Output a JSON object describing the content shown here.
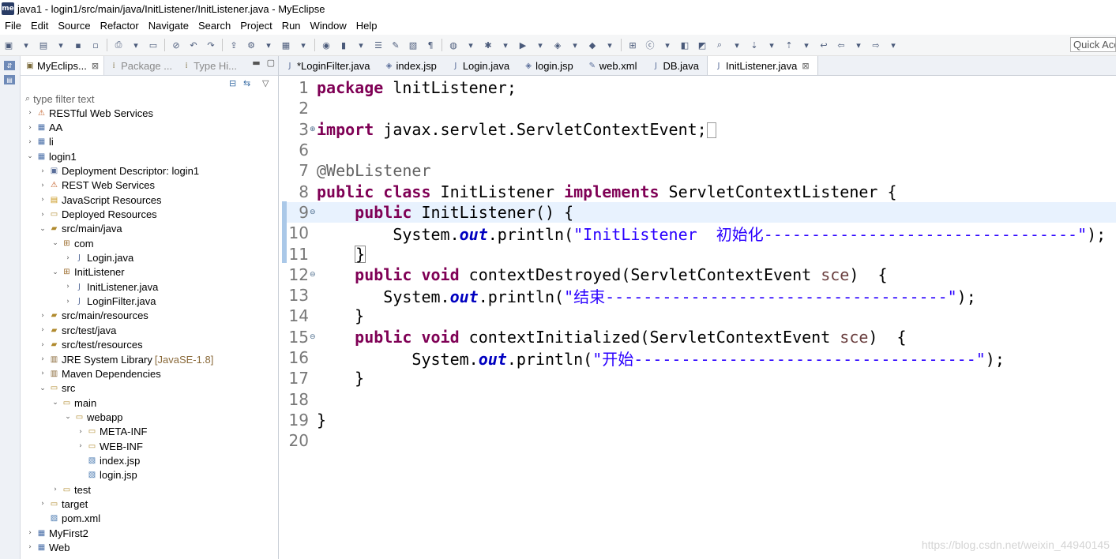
{
  "window": {
    "title": "java1 - login1/src/main/java/InitListener/InitListener.java - MyEclipse",
    "app_badge": "me"
  },
  "menu": [
    "File",
    "Edit",
    "Source",
    "Refactor",
    "Navigate",
    "Search",
    "Project",
    "Run",
    "Window",
    "Help"
  ],
  "quick_access": "Quick Access",
  "explorer": {
    "tabs": [
      {
        "label": "MyEclips...",
        "close": "⊠"
      },
      {
        "label": "Package ..."
      },
      {
        "label": "Type Hi..."
      }
    ],
    "filter_placeholder": "type filter text",
    "tree": [
      {
        "label": "RESTful Web Services",
        "indent": 0,
        "icon": "rest-icon",
        "chev": "›"
      },
      {
        "label": "AA",
        "indent": 0,
        "icon": "project-icon",
        "chev": "›"
      },
      {
        "label": "li",
        "indent": 0,
        "icon": "project-icon",
        "chev": "›"
      },
      {
        "label": "login1",
        "indent": 0,
        "icon": "project-icon",
        "chev": "⌄"
      },
      {
        "label": "Deployment Descriptor: login1",
        "indent": 1,
        "icon": "descriptor-icon",
        "chev": "›"
      },
      {
        "label": "REST Web Services",
        "indent": 1,
        "icon": "rest-icon",
        "chev": "›"
      },
      {
        "label": "JavaScript Resources",
        "indent": 1,
        "icon": "js-icon",
        "chev": "›"
      },
      {
        "label": "Deployed Resources",
        "indent": 1,
        "icon": "folder-icon",
        "chev": "›"
      },
      {
        "label": "src/main/java",
        "indent": 1,
        "icon": "source-folder-icon",
        "chev": "⌄"
      },
      {
        "label": "com",
        "indent": 2,
        "icon": "package-icon",
        "chev": "⌄"
      },
      {
        "label": "Login.java",
        "indent": 3,
        "icon": "java-file-icon",
        "chev": "›"
      },
      {
        "label": "InitListener",
        "indent": 2,
        "icon": "package-icon",
        "chev": "⌄"
      },
      {
        "label": "InitListener.java",
        "indent": 3,
        "icon": "java-file-icon",
        "chev": "›"
      },
      {
        "label": "LoginFilter.java",
        "indent": 3,
        "icon": "java-file-icon",
        "chev": "›"
      },
      {
        "label": "src/main/resources",
        "indent": 1,
        "icon": "source-folder-icon",
        "chev": "›"
      },
      {
        "label": "src/test/java",
        "indent": 1,
        "icon": "source-folder-icon",
        "chev": "›"
      },
      {
        "label": "src/test/resources",
        "indent": 1,
        "icon": "source-folder-icon",
        "chev": "›"
      },
      {
        "label": "JRE System Library",
        "extra": "[JavaSE-1.8]",
        "indent": 1,
        "icon": "library-icon",
        "chev": "›"
      },
      {
        "label": "Maven Dependencies",
        "indent": 1,
        "icon": "library-icon",
        "chev": "›"
      },
      {
        "label": "src",
        "indent": 1,
        "icon": "folder-icon",
        "chev": "⌄"
      },
      {
        "label": "main",
        "indent": 2,
        "icon": "folder-icon",
        "chev": "⌄"
      },
      {
        "label": "webapp",
        "indent": 3,
        "icon": "folder-icon",
        "chev": "⌄"
      },
      {
        "label": "META-INF",
        "indent": 4,
        "icon": "folder-icon",
        "chev": "›"
      },
      {
        "label": "WEB-INF",
        "indent": 4,
        "icon": "folder-icon",
        "chev": "›"
      },
      {
        "label": "index.jsp",
        "indent": 4,
        "icon": "jsp-file-icon",
        "chev": ""
      },
      {
        "label": "login.jsp",
        "indent": 4,
        "icon": "jsp-file-icon",
        "chev": ""
      },
      {
        "label": "test",
        "indent": 2,
        "icon": "folder-icon",
        "chev": "›"
      },
      {
        "label": "target",
        "indent": 1,
        "icon": "folder-icon",
        "chev": "›"
      },
      {
        "label": "pom.xml",
        "indent": 1,
        "icon": "xml-file-icon",
        "chev": ""
      },
      {
        "label": "MyFirst2",
        "indent": 0,
        "icon": "project-icon",
        "chev": "›"
      },
      {
        "label": "Web",
        "indent": 0,
        "icon": "project-icon",
        "chev": "›"
      }
    ]
  },
  "editor": {
    "tabs": [
      {
        "label": "*LoginFilter.java",
        "icon": "java-file-icon"
      },
      {
        "label": "index.jsp",
        "icon": "jsp-file-icon"
      },
      {
        "label": "Login.java",
        "icon": "java-file-icon"
      },
      {
        "label": "login.jsp",
        "icon": "jsp-file-icon"
      },
      {
        "label": "web.xml",
        "icon": "xml-file-icon"
      },
      {
        "label": "DB.java",
        "icon": "java-file-icon"
      },
      {
        "label": "InitListener.java",
        "icon": "java-file-icon",
        "active": true,
        "close": "⊠"
      }
    ],
    "lines": {
      "l1": {
        "num": "1",
        "kw1": "package",
        "rest": " lnitListener;"
      },
      "l2": {
        "num": "2"
      },
      "l3": {
        "num": "3",
        "kw1": "import",
        "rest": " javax.servlet.ServletContextEvent;"
      },
      "l6": {
        "num": "6"
      },
      "l7": {
        "num": "7",
        "ann": "@WebListener"
      },
      "l8": {
        "num": "8",
        "kw1": "public",
        "kw2": "class",
        "cls": " InitListener ",
        "kw3": "implements",
        "rest": " ServletContextListener {"
      },
      "l9": {
        "num": "9",
        "kw1": "public",
        "rest": " InitListener() {"
      },
      "l10": {
        "num": "10",
        "pre": "System.",
        "fld": "out",
        "mid": ".println(",
        "str": "\"InitListener  初始化---------------------------------\"",
        "post": ");"
      },
      "l11": {
        "num": "11",
        "brace": "}"
      },
      "l12": {
        "num": "12",
        "kw1": "public",
        "kw2": "void",
        "rest": " contextDestroyed(ServletContextEvent ",
        "par": "sce",
        "post": ")  {"
      },
      "l13": {
        "num": "13",
        "pre": "System.",
        "fld": "out",
        "mid": ".println(",
        "str": "\"结束------------------------------------\"",
        "post": ");"
      },
      "l14": {
        "num": "14",
        "rest": "}"
      },
      "l15": {
        "num": "15",
        "kw1": "public",
        "kw2": "void",
        "rest": " contextInitialized(ServletContextEvent ",
        "par": "sce",
        "post": ")  {"
      },
      "l16": {
        "num": "16",
        "pre": "System.",
        "fld": "out",
        "mid": ".println(",
        "str": "\"开始------------------------------------\"",
        "post": ");"
      },
      "l17": {
        "num": "17",
        "rest": "}"
      },
      "l18": {
        "num": "18"
      },
      "l19": {
        "num": "19",
        "rest": "}"
      },
      "l20": {
        "num": "20"
      }
    }
  },
  "watermark": "https://blog.csdn.net/weixin_44940145"
}
